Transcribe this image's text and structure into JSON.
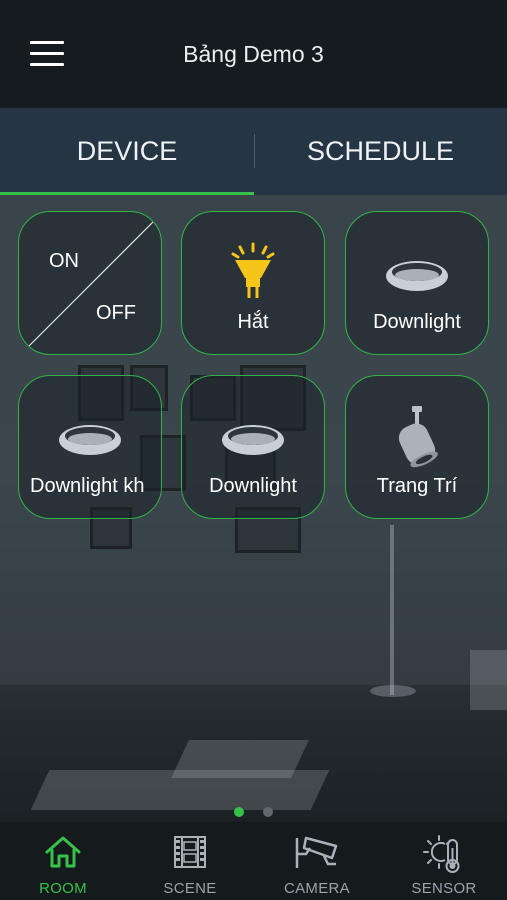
{
  "header": {
    "title": "Bảng Demo 3"
  },
  "tabs": [
    {
      "label": "DEVICE",
      "active": true
    },
    {
      "label": "SCHEDULE",
      "active": false
    }
  ],
  "tiles": [
    {
      "on_label": "ON",
      "off_label": "OFF"
    },
    {
      "label": "Hắt",
      "icon": "spotlight-lamp-icon"
    },
    {
      "label": "Downlight",
      "icon": "downlight-icon"
    },
    {
      "label": "Downlight kh",
      "icon": "downlight-icon"
    },
    {
      "label": "Downlight",
      "icon": "downlight-icon"
    },
    {
      "label": "Trang Trí",
      "icon": "track-light-icon"
    }
  ],
  "pager": {
    "count": 2,
    "active_index": 0
  },
  "bottom_nav": [
    {
      "label": "ROOM",
      "icon": "home-icon",
      "active": true
    },
    {
      "label": "SCENE",
      "icon": "film-icon",
      "active": false
    },
    {
      "label": "CAMERA",
      "icon": "cctv-camera-icon",
      "active": false
    },
    {
      "label": "SENSOR",
      "icon": "sun-thermometer-icon",
      "active": false
    }
  ],
  "colors": {
    "accent": "#36c24a",
    "header_bg": "#161b1f",
    "tab_bg": "#263543",
    "bulb": "#f5c518"
  }
}
